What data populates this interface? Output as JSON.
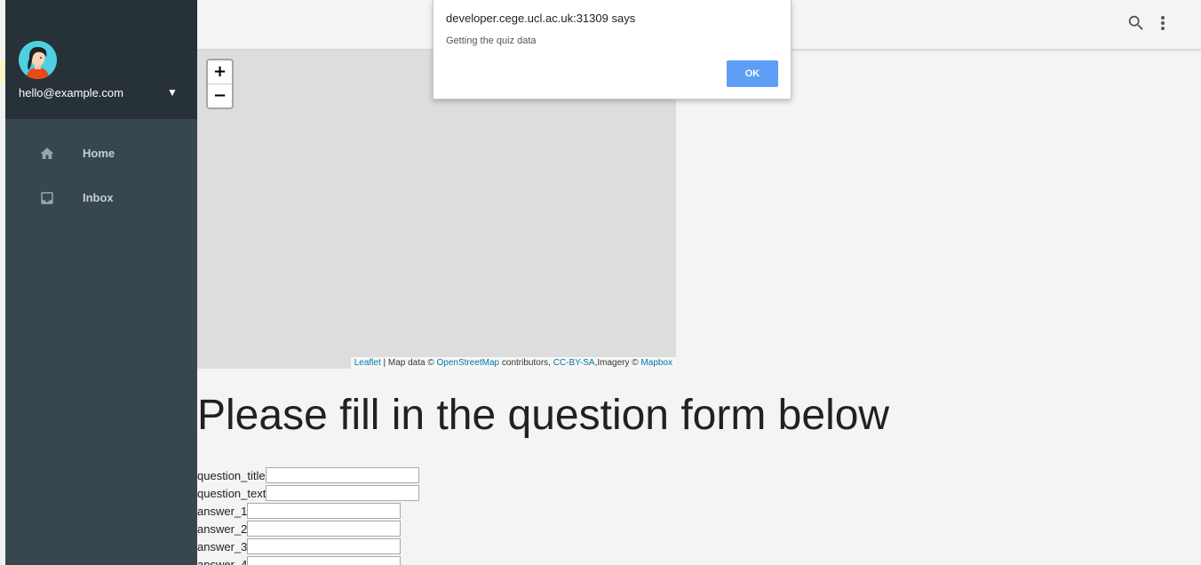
{
  "drawer": {
    "account_email": "hello@example.com",
    "items": [
      {
        "label": "Home",
        "icon": "home-icon"
      },
      {
        "label": "Inbox",
        "icon": "inbox-icon"
      }
    ]
  },
  "topbar": {
    "icons": [
      "search-icon",
      "more-vert-icon"
    ]
  },
  "map": {
    "zoom_in": "+",
    "zoom_out": "−",
    "attribution": {
      "leaflet": "Leaflet",
      "sep1": " | Map data © ",
      "osm": "OpenStreetMap",
      "contributors": " contributors, ",
      "license": "CC-BY-SA",
      "imagery": ",Imagery © ",
      "provider": "Mapbox"
    }
  },
  "form": {
    "heading": "Please fill in the question form below",
    "fields": [
      {
        "label": "question_title",
        "value": ""
      },
      {
        "label": "question_text",
        "value": ""
      },
      {
        "label": "answer_1",
        "value": ""
      },
      {
        "label": "answer_2",
        "value": ""
      },
      {
        "label": "answer_3",
        "value": ""
      },
      {
        "label": "answer_4",
        "value": ""
      }
    ]
  },
  "dialog": {
    "title": "developer.cege.ucl.ac.uk:31309 says",
    "message": "Getting the quiz data",
    "ok_label": "OK"
  },
  "colors": {
    "drawer_bg": "#37474f",
    "drawer_header_bg": "#263238",
    "ok_button": "#5e9ef6",
    "link": "#0078a8"
  }
}
